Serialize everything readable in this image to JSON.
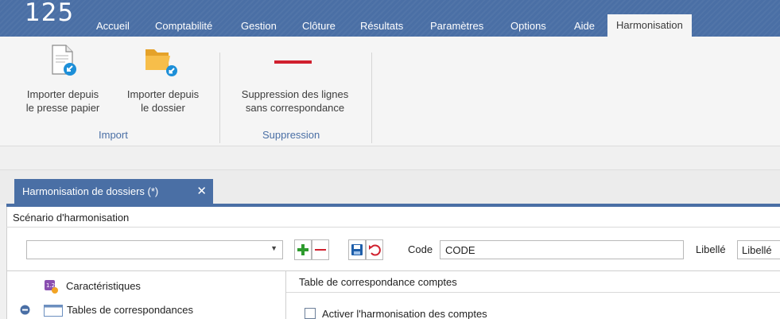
{
  "app": {
    "logo": "125"
  },
  "menu": {
    "items": [
      "Accueil",
      "Comptabilité",
      "Gestion",
      "Clôture",
      "Résultats",
      "Paramètres",
      "Options",
      "Aide"
    ],
    "active": "Harmonisation"
  },
  "ribbon": {
    "import": {
      "clipboard_line1": "Importer depuis",
      "clipboard_line2": "le presse papier",
      "folder_line1": "Importer depuis",
      "folder_line2": "le dossier",
      "group_label": "Import"
    },
    "suppression": {
      "delete_line1": "Suppression des lignes",
      "delete_line2": "sans correspondance",
      "group_label": "Suppression"
    }
  },
  "doc_tab": {
    "label": "Harmonisation de dossiers (*)",
    "close": "✕"
  },
  "scenario": {
    "title": "Scénario d'harmonisation",
    "combo_value": "",
    "code_label": "Code",
    "code_value": "CODE",
    "libelle_label": "Libellé",
    "libelle_value": "Libellé"
  },
  "tree": {
    "item1": "Caractéristiques",
    "item2": "Tables de correspondances"
  },
  "right_panel": {
    "title": "Table de correspondance comptes",
    "checkbox_label": "Activer l'harmonisation des comptes",
    "checkbox_checked": false
  },
  "colors": {
    "accent": "#4a6fa5",
    "add_green": "#2e9b2e",
    "remove_red": "#d0202e",
    "save_blue": "#1f5faa"
  }
}
